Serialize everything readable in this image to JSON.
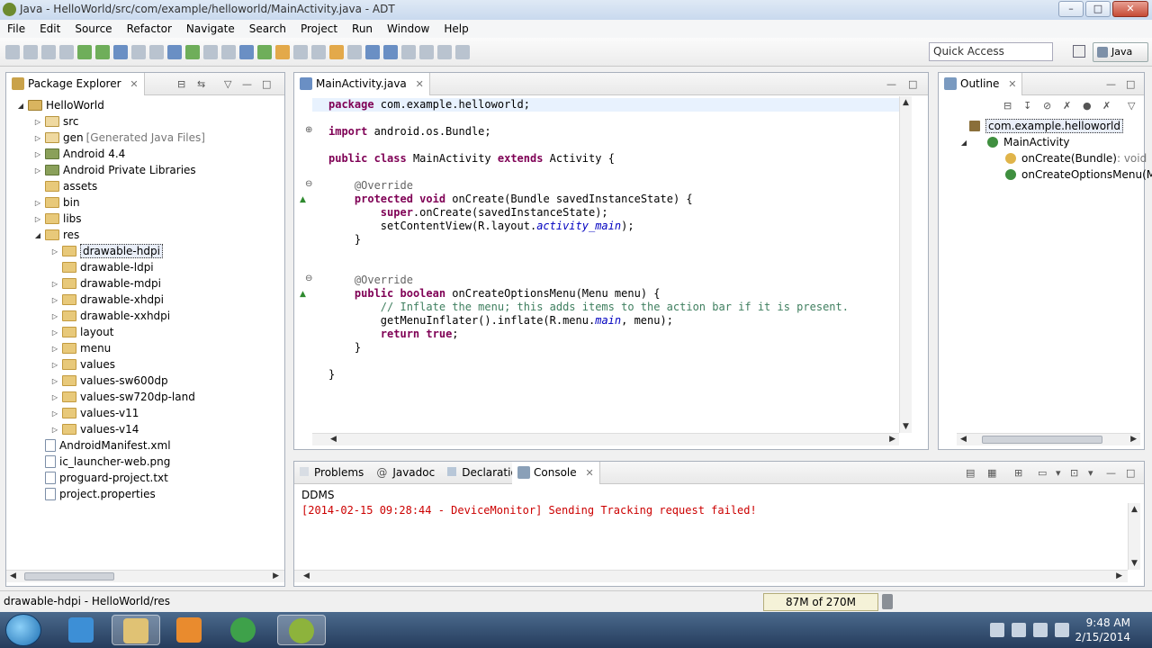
{
  "window": {
    "title": "Java - HelloWorld/src/com/example/helloworld/MainActivity.java - ADT",
    "minimize": "–",
    "maximize": "□",
    "close": "✕"
  },
  "menu": [
    "File",
    "Edit",
    "Source",
    "Refactor",
    "Navigate",
    "Search",
    "Project",
    "Run",
    "Window",
    "Help"
  ],
  "toolbar": {
    "quick_access_placeholder": "Quick Access",
    "perspective": "Java"
  },
  "package_explorer": {
    "tab_label": "Package Explorer",
    "tree": [
      {
        "label": "HelloWorld",
        "decor": "",
        "level": 0,
        "icon": "project-folder-icon",
        "twisty": "open"
      },
      {
        "label": "src",
        "decor": "",
        "level": 1,
        "icon": "source-folder-icon",
        "twisty": "closed"
      },
      {
        "label": "gen",
        "decor": "[Generated Java Files]",
        "level": 1,
        "icon": "source-folder-icon",
        "twisty": "closed"
      },
      {
        "label": "Android 4.4",
        "decor": "",
        "level": 1,
        "icon": "library-icon",
        "twisty": "closed"
      },
      {
        "label": "Android Private Libraries",
        "decor": "",
        "level": 1,
        "icon": "library-icon",
        "twisty": "closed"
      },
      {
        "label": "assets",
        "decor": "",
        "level": 1,
        "icon": "folder-icon",
        "twisty": "none"
      },
      {
        "label": "bin",
        "decor": "",
        "level": 1,
        "icon": "folder-icon",
        "twisty": "closed"
      },
      {
        "label": "libs",
        "decor": "",
        "level": 1,
        "icon": "folder-icon",
        "twisty": "closed"
      },
      {
        "label": "res",
        "decor": "",
        "level": 1,
        "icon": "folder-icon",
        "twisty": "open"
      },
      {
        "label": "drawable-hdpi",
        "decor": "",
        "level": 2,
        "icon": "folder-icon",
        "twisty": "closed",
        "selected": true
      },
      {
        "label": "drawable-ldpi",
        "decor": "",
        "level": 2,
        "icon": "folder-icon",
        "twisty": "none"
      },
      {
        "label": "drawable-mdpi",
        "decor": "",
        "level": 2,
        "icon": "folder-icon",
        "twisty": "closed"
      },
      {
        "label": "drawable-xhdpi",
        "decor": "",
        "level": 2,
        "icon": "folder-icon",
        "twisty": "closed"
      },
      {
        "label": "drawable-xxhdpi",
        "decor": "",
        "level": 2,
        "icon": "folder-icon",
        "twisty": "closed"
      },
      {
        "label": "layout",
        "decor": "",
        "level": 2,
        "icon": "folder-icon",
        "twisty": "closed"
      },
      {
        "label": "menu",
        "decor": "",
        "level": 2,
        "icon": "folder-icon",
        "twisty": "closed"
      },
      {
        "label": "values",
        "decor": "",
        "level": 2,
        "icon": "folder-icon",
        "twisty": "closed"
      },
      {
        "label": "values-sw600dp",
        "decor": "",
        "level": 2,
        "icon": "folder-icon",
        "twisty": "closed"
      },
      {
        "label": "values-sw720dp-land",
        "decor": "",
        "level": 2,
        "icon": "folder-icon",
        "twisty": "closed"
      },
      {
        "label": "values-v11",
        "decor": "",
        "level": 2,
        "icon": "folder-icon",
        "twisty": "closed"
      },
      {
        "label": "values-v14",
        "decor": "",
        "level": 2,
        "icon": "folder-icon",
        "twisty": "closed"
      },
      {
        "label": "AndroidManifest.xml",
        "decor": "",
        "level": 1,
        "icon": "xml-file-icon",
        "twisty": "none"
      },
      {
        "label": "ic_launcher-web.png",
        "decor": "",
        "level": 1,
        "icon": "image-file-icon",
        "twisty": "none"
      },
      {
        "label": "proguard-project.txt",
        "decor": "",
        "level": 1,
        "icon": "text-file-icon",
        "twisty": "none"
      },
      {
        "label": "project.properties",
        "decor": "",
        "level": 1,
        "icon": "text-file-icon",
        "twisty": "none"
      }
    ]
  },
  "editor": {
    "tab_label": "MainActivity.java",
    "lines": [
      [
        {
          "t": "package",
          "c": "kw"
        },
        {
          "t": " com.example.helloworld;",
          "c": ""
        }
      ],
      [],
      [
        {
          "t": "import",
          "c": "kw"
        },
        {
          "t": " android.os.Bundle;",
          "c": ""
        }
      ],
      [],
      [
        {
          "t": "public",
          "c": "kw"
        },
        {
          "t": " ",
          "c": ""
        },
        {
          "t": "class",
          "c": "kw"
        },
        {
          "t": " MainActivity ",
          "c": ""
        },
        {
          "t": "extends",
          "c": "kw"
        },
        {
          "t": " Activity {",
          "c": ""
        }
      ],
      [],
      [
        {
          "t": "    @Override",
          "c": "ann"
        }
      ],
      [
        {
          "t": "    ",
          "c": ""
        },
        {
          "t": "protected",
          "c": "kw"
        },
        {
          "t": " ",
          "c": ""
        },
        {
          "t": "void",
          "c": "kw"
        },
        {
          "t": " onCreate(Bundle savedInstanceState) {",
          "c": ""
        }
      ],
      [
        {
          "t": "        ",
          "c": ""
        },
        {
          "t": "super",
          "c": "kw"
        },
        {
          "t": ".onCreate(savedInstanceState);",
          "c": ""
        }
      ],
      [
        {
          "t": "        setContentView(R.layout.",
          "c": ""
        },
        {
          "t": "activity_main",
          "c": "fld"
        },
        {
          "t": ");",
          "c": ""
        }
      ],
      [
        {
          "t": "    }",
          "c": ""
        }
      ],
      [],
      [],
      [
        {
          "t": "    @Override",
          "c": "ann"
        }
      ],
      [
        {
          "t": "    ",
          "c": ""
        },
        {
          "t": "public",
          "c": "kw"
        },
        {
          "t": " ",
          "c": ""
        },
        {
          "t": "boolean",
          "c": "kw"
        },
        {
          "t": " onCreateOptionsMenu(Menu menu) {",
          "c": ""
        }
      ],
      [
        {
          "t": "        // Inflate the menu; this adds items to the action bar if it is present.",
          "c": "cmt"
        }
      ],
      [
        {
          "t": "        getMenuInflater().inflate(R.menu.",
          "c": ""
        },
        {
          "t": "main",
          "c": "fld"
        },
        {
          "t": ", menu);",
          "c": ""
        }
      ],
      [
        {
          "t": "        ",
          "c": ""
        },
        {
          "t": "return",
          "c": "kw"
        },
        {
          "t": " ",
          "c": ""
        },
        {
          "t": "true",
          "c": "kw"
        },
        {
          "t": ";",
          "c": ""
        }
      ],
      [
        {
          "t": "    }",
          "c": ""
        }
      ],
      [],
      [
        {
          "t": "}",
          "c": ""
        }
      ]
    ]
  },
  "outline": {
    "tab_label": "Outline",
    "items": [
      {
        "label": "com.example.helloworld",
        "detail": "",
        "level": 0,
        "icon": "package-icon",
        "selected": true
      },
      {
        "label": "MainActivity",
        "detail": "",
        "level": 1,
        "icon": "class-icon"
      },
      {
        "label": "onCreate(Bundle)",
        "detail": " : void",
        "level": 2,
        "icon": "protected-method-icon"
      },
      {
        "label": "onCreateOptionsMenu(Me",
        "detail": "",
        "level": 2,
        "icon": "public-method-icon"
      }
    ]
  },
  "bottom_panel": {
    "tabs": [
      "Problems",
      "Javadoc",
      "Declaration",
      "Console"
    ],
    "active_tab": "Console",
    "console_title": "DDMS",
    "console_lines": [
      "[2014-02-15 09:28:44 - DeviceMonitor] Sending Tracking request failed!"
    ]
  },
  "status_bar": {
    "text": "drawable-hdpi - HelloWorld/res",
    "heap": "87M of 270M"
  },
  "taskbar": {
    "time": "9:48 AM",
    "date": "2/15/2014"
  },
  "colors": {
    "keyword": "#7f0055",
    "annotation": "#646464",
    "comment": "#3f7f5f",
    "field": "#0000c0",
    "console_error": "#cc0000"
  }
}
